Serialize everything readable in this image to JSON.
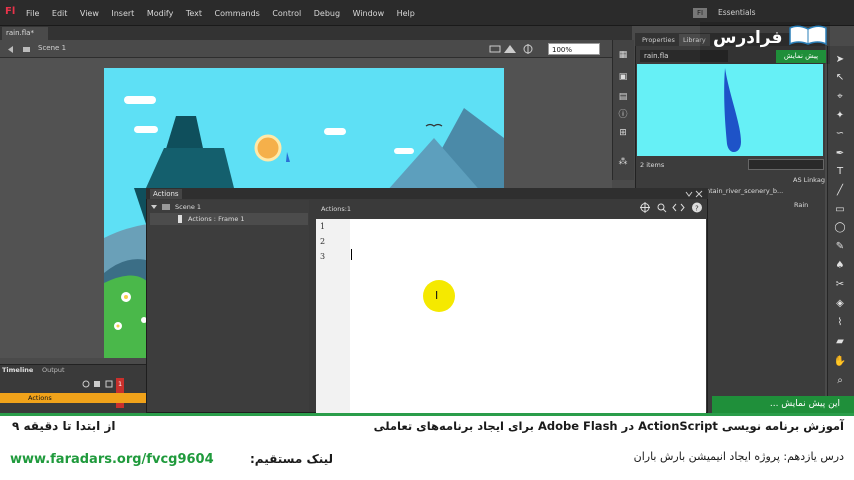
{
  "app": {
    "logo": "Fl",
    "workspace": "Essentials",
    "fi_label": "FI"
  },
  "menu": [
    "File",
    "Edit",
    "View",
    "Insert",
    "Modify",
    "Text",
    "Commands",
    "Control",
    "Debug",
    "Window",
    "Help"
  ],
  "document": {
    "tab": "rain.fla*",
    "scene": "Scene 1",
    "zoom": "100%"
  },
  "library": {
    "tabs": [
      "Properties",
      "Library"
    ],
    "file": "rain.fla",
    "items_count": "2 items",
    "rows": [
      "ntain_river_scenery_b...",
      "Rain"
    ],
    "linkage_header": "AS Linkag"
  },
  "actions": {
    "title": "Actions",
    "tree_scene": "Scene 1",
    "tree_frame": "Actions : Frame 1",
    "script_title": "Actions:1",
    "line_numbers": [
      "1",
      "2",
      "3"
    ]
  },
  "timeline": {
    "tab": "Timeline",
    "output_tab": "Output",
    "layer": "Actions",
    "frame_number": "1"
  },
  "banner": {
    "tag": "این پیش نمایش ...",
    "line1": "آموزش برنامه نویسی ActionScript در Adobe Flash برای ایجاد برنامه‌های تعاملی",
    "line2": "درس یازدهم: پروژه ایجاد انیمیشن بارش باران",
    "from": "از ابتدا تا دقیقه ۹",
    "link_label": "لینک مستقیم:",
    "link": "www.faradars.org/fvcg9604"
  },
  "logo": {
    "name": "فرادرس",
    "preview": "پیش نمایش"
  },
  "colors": {
    "accent_green": "#1f8f3a",
    "sky": "#5ee0f5",
    "flash_red": "#e8334a",
    "layer_orange": "#f0a21a"
  }
}
